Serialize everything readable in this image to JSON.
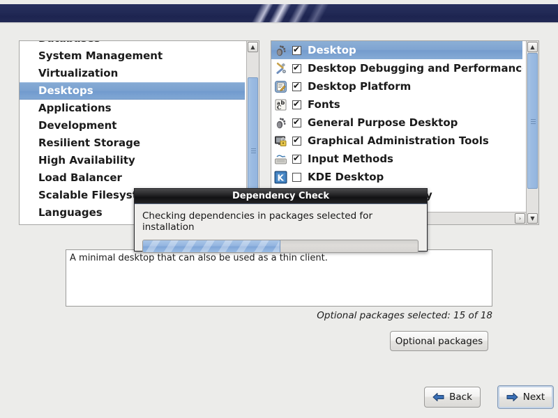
{
  "banner": {
    "name": "installer-banner"
  },
  "left_panel": {
    "name": "package-group-list",
    "items": [
      {
        "label": "Databases",
        "selected": false,
        "clipped_top": true
      },
      {
        "label": "System Management",
        "selected": false
      },
      {
        "label": "Virtualization",
        "selected": false
      },
      {
        "label": "Desktops",
        "selected": true
      },
      {
        "label": "Applications",
        "selected": false
      },
      {
        "label": "Development",
        "selected": false
      },
      {
        "label": "Resilient Storage",
        "selected": false
      },
      {
        "label": "High Availability",
        "selected": false
      },
      {
        "label": "Load Balancer",
        "selected": false
      },
      {
        "label": "Scalable Filesystems",
        "selected": false
      },
      {
        "label": "Languages",
        "selected": false
      }
    ],
    "scrollbar": {
      "up_arrow": "▲",
      "thumb_grip": "grip"
    }
  },
  "right_panel": {
    "name": "package-subgroup-list",
    "items": [
      {
        "label": "Desktop",
        "checked": true,
        "selected": true,
        "icon": "gnome-footprint-icon"
      },
      {
        "label": "Desktop Debugging and Performance Tools",
        "checked": true,
        "selected": false,
        "icon": "tools-icon"
      },
      {
        "label": "Desktop Platform",
        "checked": true,
        "selected": false,
        "icon": "platform-icon"
      },
      {
        "label": "Fonts",
        "checked": true,
        "selected": false,
        "icon": "fonts-icon"
      },
      {
        "label": "General Purpose Desktop",
        "checked": true,
        "selected": false,
        "icon": "gnome-footprint-icon"
      },
      {
        "label": "Graphical Administration Tools",
        "checked": true,
        "selected": false,
        "icon": "monitor-lock-icon"
      },
      {
        "label": "Input Methods",
        "checked": true,
        "selected": false,
        "icon": "keyboard-icon"
      },
      {
        "label": "KDE Desktop",
        "checked": false,
        "selected": false,
        "icon": "kde-icon"
      },
      {
        "label": "System compatibility",
        "checked": false,
        "selected": false,
        "icon": "compat-icon"
      }
    ],
    "vscroll": {
      "up_arrow": "▲",
      "down_arrow": "▼"
    },
    "hscroll": {
      "right_arrow": "›"
    }
  },
  "description": {
    "name": "group-description",
    "text": "A minimal desktop that can also be used as a thin client."
  },
  "optional": {
    "count_label": "Optional packages selected: 15 of 18",
    "button_label": "Optional packages"
  },
  "navigation": {
    "back_label": "Back",
    "next_label": "Next"
  },
  "dialog": {
    "title": "Dependency Check",
    "message": "Checking dependencies in packages selected for installation",
    "progress_percent": 50
  },
  "colors": {
    "banner": "#232a55",
    "selection_blue": "#7ba2d0",
    "progress_blue": "#94b5e0",
    "window_bg": "#ececea",
    "dialog_titlebar": "#121214"
  }
}
